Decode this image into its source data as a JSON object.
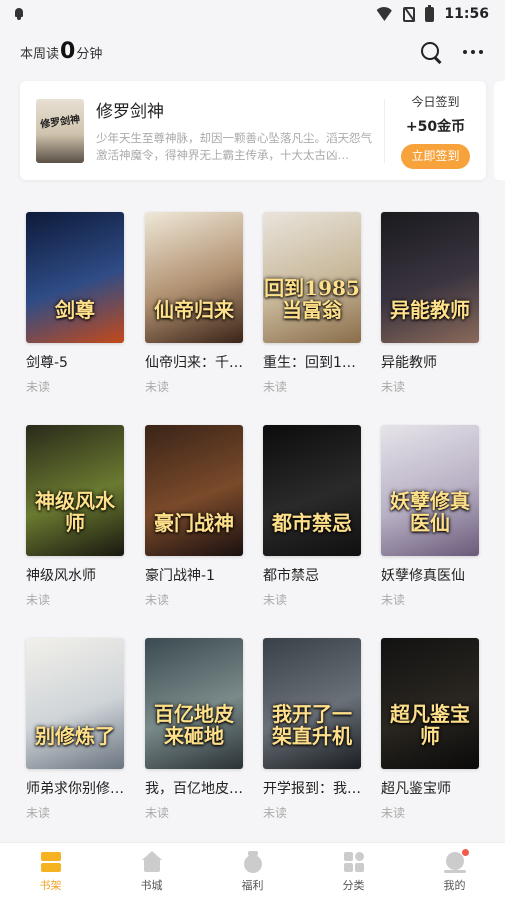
{
  "status_bar": {
    "time": "11:56"
  },
  "header": {
    "read_prefix": "本周读",
    "read_minutes": "0",
    "read_suffix": "分钟"
  },
  "recommend": {
    "cover_text": "修罗剑神",
    "title": "修罗剑神",
    "desc": "少年天生至尊神脉，却因一颗善心坠落凡尘。滔天怨气激活神魔令，得神界无上霸主传承，十大太古凶…",
    "checkin_label": "今日签到",
    "reward": "+50金币",
    "button": "立即签到",
    "accent": "#f7a23b"
  },
  "books": [
    {
      "cover_text": "剑尊",
      "name": "剑尊-5",
      "status": "未读",
      "colors": [
        "#0d1a3a",
        "#2f4c86",
        "#c44a1a"
      ]
    },
    {
      "cover_text": "仙帝归来",
      "name": "仙帝归来：千…",
      "status": "未读",
      "colors": [
        "#efe8d8",
        "#b09070",
        "#3a2418"
      ]
    },
    {
      "cover_text": "回到1985当富翁",
      "name": "重生：回到19…",
      "status": "未读",
      "colors": [
        "#e9e4dc",
        "#c8b89a",
        "#8a6d4a"
      ]
    },
    {
      "cover_text": "异能教师",
      "name": "异能教师",
      "status": "未读",
      "colors": [
        "#1a1a1e",
        "#3a3440",
        "#8a6a5a"
      ]
    },
    {
      "cover_text": "神级风水师",
      "name": "神级风水师",
      "status": "未读",
      "colors": [
        "#2a2a1a",
        "#6a7a30",
        "#1a1810"
      ]
    },
    {
      "cover_text": "豪门战神",
      "name": "豪门战神-1",
      "status": "未读",
      "colors": [
        "#3a2418",
        "#7a4a2a",
        "#1a1010"
      ]
    },
    {
      "cover_text": "都市禁忌",
      "name": "都市禁忌",
      "status": "未读",
      "colors": [
        "#0c0c0c",
        "#2a2a2a",
        "#101010"
      ]
    },
    {
      "cover_text": "妖孽修真医仙",
      "name": "妖孽修真医仙",
      "status": "未读",
      "colors": [
        "#e6e4ea",
        "#b8b0c4",
        "#6a5a7a"
      ]
    },
    {
      "cover_text": "别修炼了",
      "name": "师弟求你别修…",
      "status": "未读",
      "colors": [
        "#f2f0ea",
        "#cfd4d8",
        "#6a7480"
      ]
    },
    {
      "cover_text": "百亿地皮来砸地",
      "name": "我，百亿地皮…",
      "status": "未读",
      "colors": [
        "#3a4a50",
        "#7a8a8a",
        "#2a3236"
      ]
    },
    {
      "cover_text": "我开了一架直升机",
      "name": "开学报到：我…",
      "status": "未读",
      "colors": [
        "#3a4048",
        "#6a7078",
        "#1a1e22"
      ]
    },
    {
      "cover_text": "超凡鉴宝师",
      "name": "超凡鉴宝师",
      "status": "未读",
      "colors": [
        "#121212",
        "#2a2620",
        "#0a0a0a"
      ]
    }
  ],
  "nav": {
    "tabs": [
      {
        "label": "书架",
        "icon": "bookshelf-icon",
        "active": true
      },
      {
        "label": "书城",
        "icon": "bookstore-icon",
        "active": false
      },
      {
        "label": "福利",
        "icon": "welfare-icon",
        "active": false
      },
      {
        "label": "分类",
        "icon": "category-icon",
        "active": false
      },
      {
        "label": "我的",
        "icon": "profile-icon",
        "active": false
      }
    ],
    "active_color": "#f0a428"
  }
}
